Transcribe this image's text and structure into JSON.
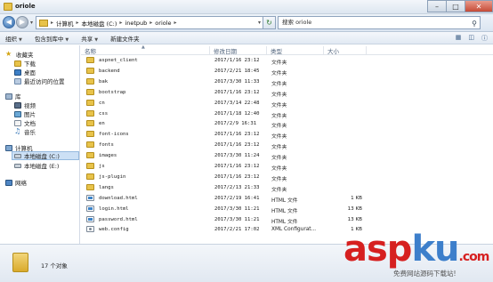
{
  "window": {
    "title": "oriole"
  },
  "address": {
    "crumbs": [
      "计算机",
      "本地磁盘 (C:)",
      "inetpub",
      "oriole"
    ],
    "search_placeholder": "搜索 oriole"
  },
  "toolbar": {
    "organize": "组织",
    "include_in_library": "包含到库中",
    "share": "共享",
    "new_folder": "新建文件夹"
  },
  "sidebar": {
    "favorites": "收藏夹",
    "downloads": "下载",
    "desktop": "桌面",
    "recent": "最近访问的位置",
    "libraries": "库",
    "videos": "视频",
    "pictures": "图片",
    "documents": "文档",
    "music": "音乐",
    "computer": "计算机",
    "drive_c": "本地磁盘 (C:)",
    "drive_e": "本地磁盘 (E:)",
    "network": "网络"
  },
  "columns": {
    "name": "名称",
    "date": "修改日期",
    "type": "类型",
    "size": "大小"
  },
  "files": [
    {
      "name": "aspnet_client",
      "date": "2017/1/16 23:12",
      "type": "文件夹",
      "size": "",
      "kind": "folder"
    },
    {
      "name": "backend",
      "date": "2017/2/21 18:45",
      "type": "文件夹",
      "size": "",
      "kind": "folder"
    },
    {
      "name": "bak",
      "date": "2017/3/30 11:33",
      "type": "文件夹",
      "size": "",
      "kind": "folder"
    },
    {
      "name": "bootstrap",
      "date": "2017/1/16 23:12",
      "type": "文件夹",
      "size": "",
      "kind": "folder"
    },
    {
      "name": "cn",
      "date": "2017/3/14 22:48",
      "type": "文件夹",
      "size": "",
      "kind": "folder"
    },
    {
      "name": "css",
      "date": "2017/1/18 12:40",
      "type": "文件夹",
      "size": "",
      "kind": "folder"
    },
    {
      "name": "en",
      "date": "2017/2/9 16:31",
      "type": "文件夹",
      "size": "",
      "kind": "folder"
    },
    {
      "name": "font-icons",
      "date": "2017/1/16 23:12",
      "type": "文件夹",
      "size": "",
      "kind": "folder"
    },
    {
      "name": "fonts",
      "date": "2017/1/16 23:12",
      "type": "文件夹",
      "size": "",
      "kind": "folder"
    },
    {
      "name": "images",
      "date": "2017/3/30 11:24",
      "type": "文件夹",
      "size": "",
      "kind": "folder"
    },
    {
      "name": "js",
      "date": "2017/1/16 23:12",
      "type": "文件夹",
      "size": "",
      "kind": "folder"
    },
    {
      "name": "js-plugin",
      "date": "2017/1/16 23:12",
      "type": "文件夹",
      "size": "",
      "kind": "folder"
    },
    {
      "name": "langs",
      "date": "2017/2/13 21:33",
      "type": "文件夹",
      "size": "",
      "kind": "folder"
    },
    {
      "name": "download.html",
      "date": "2017/2/19 16:41",
      "type": "HTML 文件",
      "size": "1 KB",
      "kind": "html"
    },
    {
      "name": "login.html",
      "date": "2017/3/30 11:21",
      "type": "HTML 文件",
      "size": "13 KB",
      "kind": "html"
    },
    {
      "name": "password.html",
      "date": "2017/3/30 11:21",
      "type": "HTML 文件",
      "size": "13 KB",
      "kind": "html"
    },
    {
      "name": "web.config",
      "date": "2017/2/21 17:02",
      "type": "XML Configurat...",
      "size": "1 KB",
      "kind": "config"
    }
  ],
  "status": {
    "count": "17 个对象"
  },
  "watermark": {
    "brand_a": "asp",
    "brand_b": "ku",
    "brand_c": ".com",
    "sub": "免费网站源码下载站!"
  }
}
